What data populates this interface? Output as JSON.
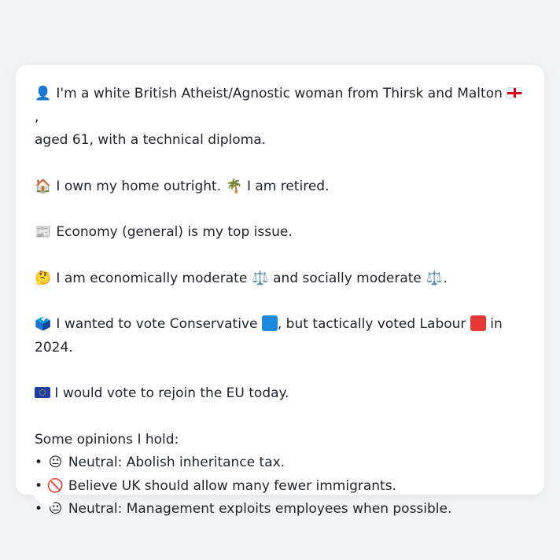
{
  "profile": {
    "line1_icon": "person-silhouette-icon",
    "line1_text_a": "I'm a white British Atheist/Agnostic woman from Thirsk and Malton",
    "line1_flag": "england-flag-icon",
    "line1_text_b": ",",
    "line2_text": "aged 61, with a technical diploma.",
    "home_icon": "house-icon",
    "home_text": "I own my home outright.",
    "retired_icon": "palm-tree-icon",
    "retired_text": "I am retired.",
    "issue_icon": "newspaper-icon",
    "issue_text": "Economy (general) is my top issue.",
    "ideology_icon": "thinking-face-icon",
    "ideology_text_a": "I am economically moderate",
    "ideology_scale_icon": "balance-scale-icon",
    "ideology_text_b": "and socially moderate",
    "ideology_end": ".",
    "vote_icon": "ballot-box-icon",
    "vote_text_a": "I wanted to vote Conservative",
    "vote_text_b": ", but tactically voted Labour",
    "vote_text_c": "in 2024.",
    "conservative_color": "#1e88e5",
    "labour_color": "#e53935",
    "eu_icon": "eu-flag-icon",
    "eu_text": "I would vote to rejoin the EU today.",
    "eu_color": "#1f3fa5"
  },
  "opinions": {
    "heading": "Some opinions I hold:",
    "items": [
      {
        "icon": "neutral-face-icon",
        "text": "Neutral: Abolish inheritance tax."
      },
      {
        "icon": "prohibited-icon",
        "text": "Believe UK should allow many fewer immigrants."
      },
      {
        "icon": "neutral-face-icon",
        "text": "Neutral: Management exploits employees when possible."
      }
    ]
  }
}
